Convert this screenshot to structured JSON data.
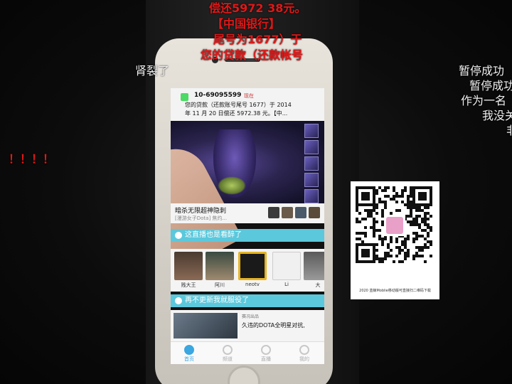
{
  "danmaku": {
    "top_line_1": "偿还5972 38元。",
    "top_line_2": "【中国银行】",
    "top_line_3": "尾号为1677）于",
    "top_line_4": "您的贷款（还款帐号",
    "left_1": "肾裂了",
    "left_2": "！！！！",
    "right_1": "暂停成功",
    "right_2": "暂停成功",
    "right_3": "作为一名",
    "right_4": "我没关",
    "right_5": "非"
  },
  "notification": {
    "sender": "10-69095599",
    "time": "现在",
    "line_1": "您的贷款（还款账号尾号 1677）于 2014",
    "line_2": "年 11 月 20 日偿还 5972.38 元。【中..."
  },
  "app": {
    "promo_title": "暗杀无限超神隐刺",
    "promo_sub": "[漫游女子Dota] 焦灼..."
  },
  "sections": {
    "streamers_title": "这直播也是看醉了",
    "news_title": "再不更新我就服役了"
  },
  "streamers": [
    {
      "name": "贱大王"
    },
    {
      "name": "阿川"
    },
    {
      "name": "neotv"
    },
    {
      "name": "Li"
    },
    {
      "name": "大"
    }
  ],
  "news": {
    "tag": "赛况出品",
    "title": "久违的DOTA全明星对抗,"
  },
  "tabs": [
    {
      "label": "首页"
    },
    {
      "label": "频道"
    },
    {
      "label": "直播"
    },
    {
      "label": "我的"
    }
  ],
  "qr": {
    "caption": "2020 蓝鲸Moblie移动版可直接扫二维码下载"
  },
  "colors": {
    "danmaku_red": "#e01818",
    "section_blue": "#5bc8dc",
    "tab_active": "#3aa7e0"
  }
}
